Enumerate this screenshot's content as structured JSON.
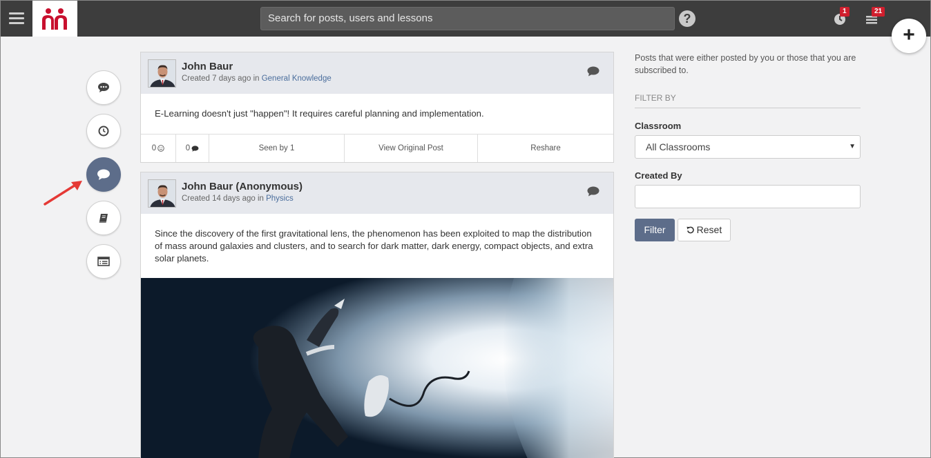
{
  "header": {
    "search_placeholder": "Search for posts, users and lessons",
    "help_label": "?",
    "notifications_count": "1",
    "tasks_count": "21",
    "add_label": "+"
  },
  "colors": {
    "topbar": "#3d3d3d",
    "accent": "#5d6d8a",
    "badge": "#d01f2e",
    "logo": "#c8102e"
  },
  "rail": {
    "items": [
      {
        "name": "chat-icon",
        "active": false
      },
      {
        "name": "clock-icon",
        "active": false
      },
      {
        "name": "comment-icon",
        "active": true
      },
      {
        "name": "book-icon",
        "active": false
      },
      {
        "name": "list-icon",
        "active": false
      }
    ]
  },
  "posts": [
    {
      "author": "John Baur",
      "created": "Created 7 days ago in ",
      "category": "General Knowledge",
      "body": "E-Learning doesn't just \"happen\"! It requires careful planning and implementation.",
      "likes": "0",
      "comments": "0",
      "seen": "Seen by 1",
      "view_original": "View Original Post",
      "reshare": "Reshare"
    },
    {
      "author": "John Baur (Anonymous)",
      "created": "Created 14 days ago in ",
      "category": "Physics",
      "body": "Since the discovery of the first gravitational lens, the phenomenon has been exploited to map the distribution of mass around galaxies and clusters, and to search for dark matter, dark energy, compact objects, and extra solar planets."
    }
  ],
  "sidebar": {
    "intro": "Posts that were either posted by you or those that you are subscribed to.",
    "filter_by": "FILTER BY",
    "classroom_label": "Classroom",
    "classroom_value": "All Classrooms",
    "created_by_label": "Created By",
    "created_by_value": "",
    "filter_button": "Filter",
    "reset_button": "Reset"
  }
}
